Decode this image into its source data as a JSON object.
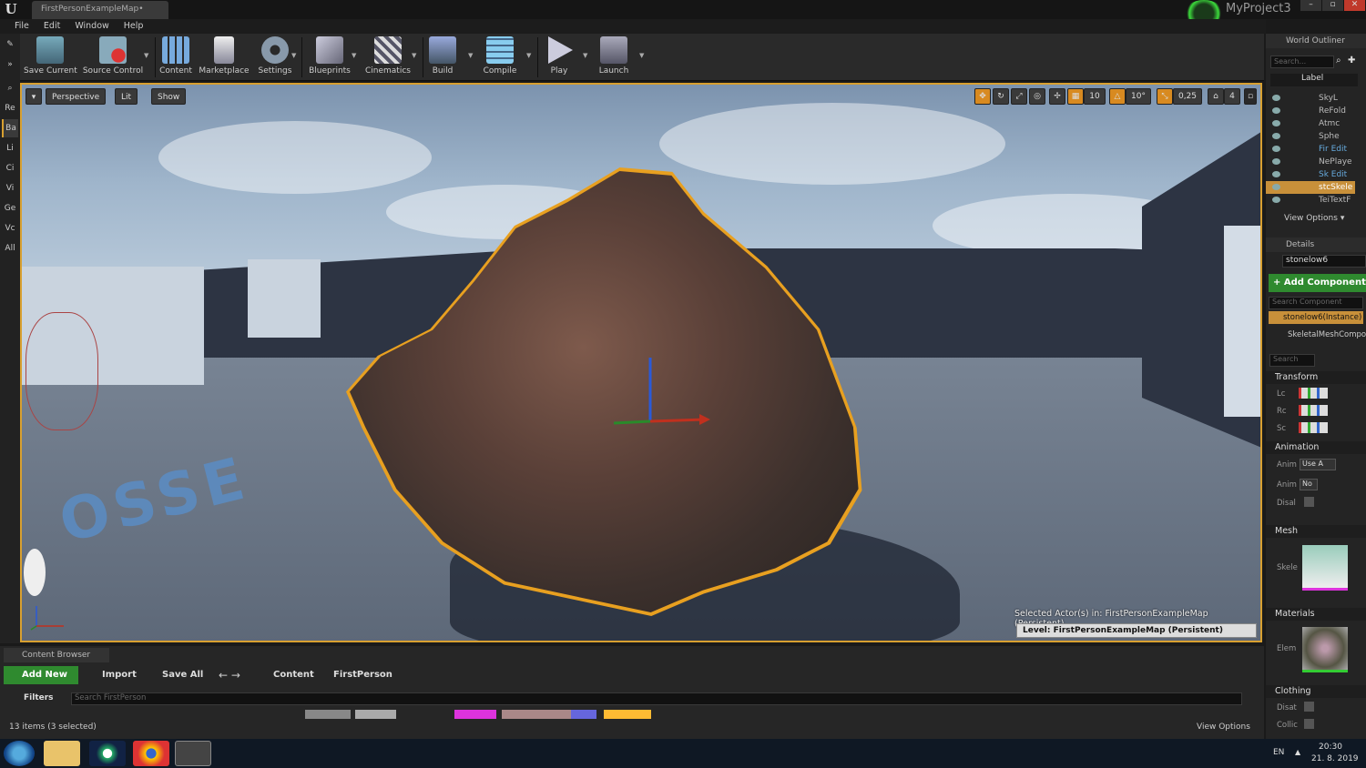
{
  "app": {
    "tab_title": "FirstPersonExampleMap•",
    "project_name": "MyProject3",
    "window_controls": [
      "–",
      "▫",
      "✕"
    ]
  },
  "menu": [
    "File",
    "Edit",
    "Window",
    "Help"
  ],
  "toolbar": {
    "save_current": "Save Current",
    "source_control": "Source Control",
    "content": "Content",
    "marketplace": "Marketplace",
    "settings": "Settings",
    "blueprints": "Blueprints",
    "cinematics": "Cinematics",
    "build": "Build",
    "compile": "Compile",
    "play": "Play",
    "launch": "Launch"
  },
  "modes": [
    "Re",
    "Ba",
    "Li",
    "Ci",
    "Vi",
    "Ge",
    "Vc",
    "All"
  ],
  "viewport": {
    "perspective": "Perspective",
    "lit": "Lit",
    "show": "Show",
    "grid_snap": "10",
    "rot_snap": "10°",
    "scale_snap": "0,25",
    "cam_speed": "4",
    "floor_text": "OSSE",
    "selected_info": "Selected Actor(s) in:  FirstPersonExampleMap (Persistent)",
    "level_info": "Level:  FirstPersonExampleMap (Persistent)"
  },
  "outliner": {
    "title": "World Outliner",
    "search_placeholder": "Search...",
    "label_header": "Label",
    "rows": [
      "SkyL",
      "ReFold",
      "Atmc",
      "Sphe",
      "Fir Edit",
      "NePlaye",
      "Sk Edit",
      "stcSkele",
      "TeiTextF"
    ],
    "view_options": "View Options"
  },
  "details": {
    "title": "Details",
    "actor_name": "stonelow6",
    "add_component": "+ Add Component",
    "search_components_placeholder": "Search Component",
    "instance": "stonelow6(Instance)",
    "skeletal": "SkeletalMeshCompo",
    "search_placeholder": "Search",
    "sections": {
      "transform": "Transform",
      "animation": "Animation",
      "mesh": "Mesh",
      "materials": "Materials",
      "clothing": "Clothing"
    },
    "props": {
      "loc": "Lc",
      "rot": "Rc",
      "scale": "Sc",
      "anim_mode": "Anim",
      "anim_mode_value": "Use A",
      "anim_class": "Anim",
      "anim_class_value": "No",
      "disable": "Disal",
      "skel": "Skele",
      "elem": "Elem",
      "cloth_disable": "Disat",
      "collide": "Collic"
    }
  },
  "content_browser": {
    "title": "Content Browser",
    "add_new": "Add New",
    "import": "Import",
    "save_all": "Save All",
    "path_root": "Content",
    "path_folder": "FirstPerson",
    "filters": "Filters",
    "search_placeholder": "Search FirstPerson",
    "item_count": "13 items (3 selected)",
    "view_options": "View Options"
  },
  "taskbar": {
    "lang": "EN",
    "time": "20:30",
    "date": "21. 8. 2019"
  }
}
